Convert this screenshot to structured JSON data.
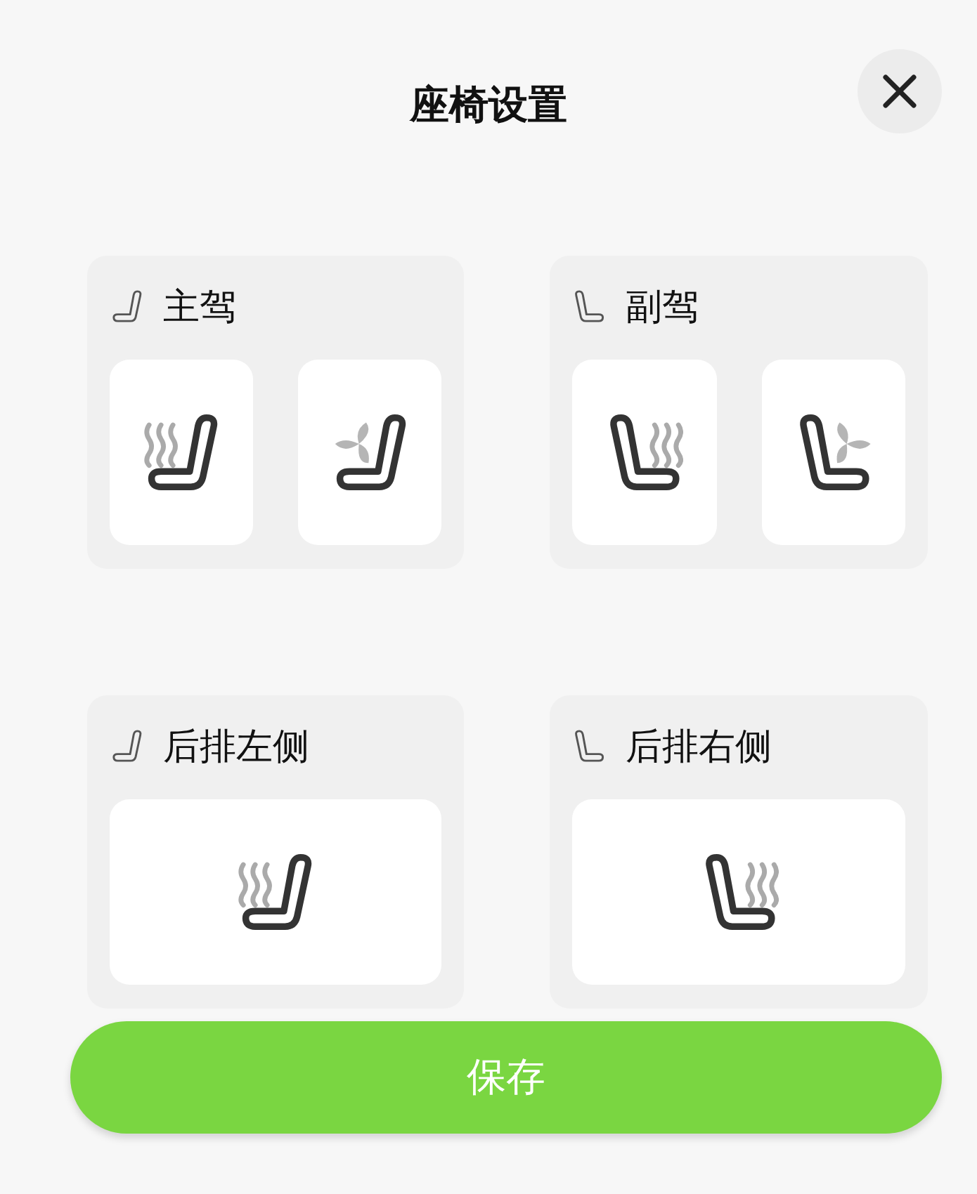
{
  "title": "座椅设置",
  "seats": [
    {
      "name": "主驾",
      "kind": "left",
      "controls": [
        {
          "kind": "heat"
        },
        {
          "kind": "vent"
        }
      ]
    },
    {
      "name": "副驾",
      "kind": "right",
      "controls": [
        {
          "kind": "heat"
        },
        {
          "kind": "vent"
        }
      ]
    },
    {
      "name": "后排左侧",
      "kind": "left",
      "controls": [
        {
          "kind": "heat"
        }
      ]
    },
    {
      "name": "后排右侧",
      "kind": "right",
      "controls": [
        {
          "kind": "heat"
        }
      ]
    }
  ],
  "save_button": "保存"
}
